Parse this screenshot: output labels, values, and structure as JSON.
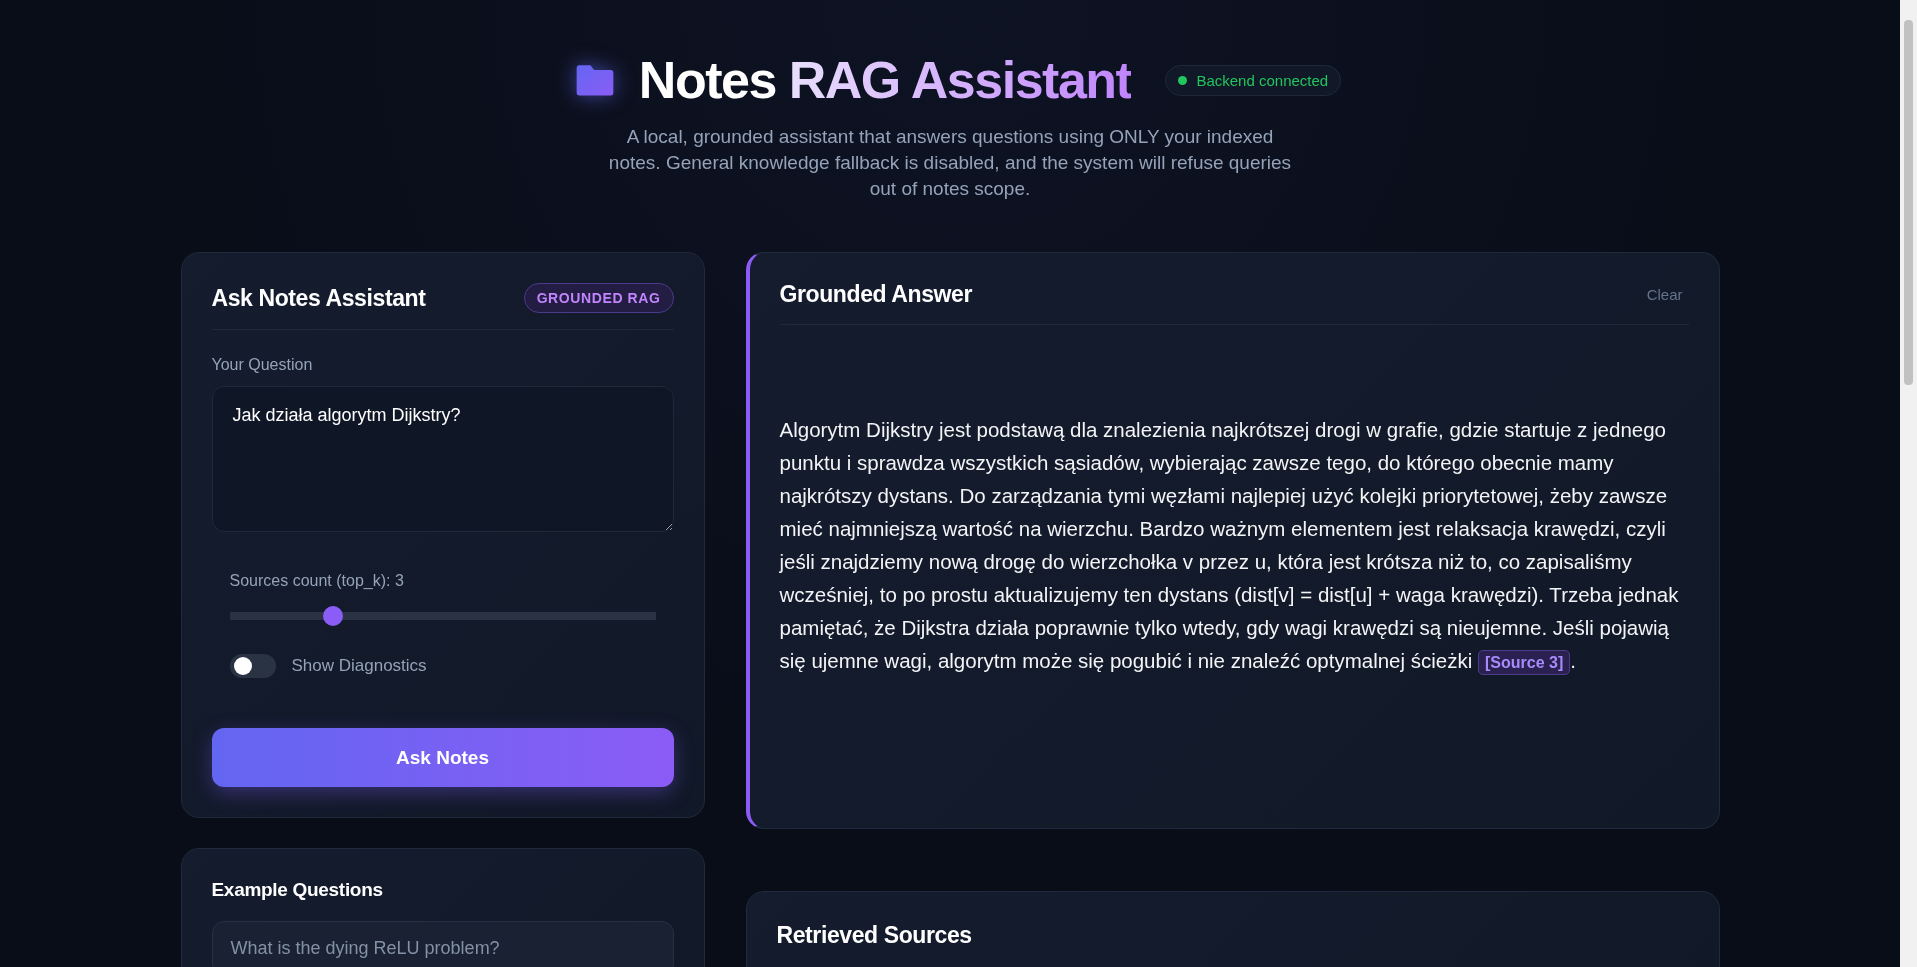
{
  "header": {
    "title_start": "Notes",
    "title_end": "RAG Assistant",
    "status": {
      "label": "Backend connected",
      "connected": true
    },
    "subtitle": "A local, grounded assistant that answers questions using ONLY your indexed notes. General knowledge fallback is disabled, and the system will refuse queries out of notes scope."
  },
  "ask_panel": {
    "title": "Ask Notes Assistant",
    "badge": "GROUNDED RAG",
    "question_label": "Your Question",
    "question_value": "Jak działa algorytm Dijkstry?",
    "slider": {
      "label": "Sources count (top_k): 3",
      "level": 0.23
    },
    "diagnostics_toggle": {
      "label": "Show Diagnostics",
      "checked": false
    },
    "submit_button": "Ask Notes"
  },
  "examples_panel": {
    "title": "Example Questions",
    "items": [
      "What is the dying ReLU problem?"
    ]
  },
  "answer_panel": {
    "title": "Grounded Answer",
    "clear_button": "Clear",
    "text": "Algorytm Dijkstry jest podstawą dla znalezienia najkrótszej drogi w grafie, gdzie startuje z jednego punktu i sprawdza wszystkich sąsiadów, wybierając zawsze tego, do którego obecnie mamy najkrótszy dystans. Do zarządzania tymi węzłami najlepiej użyć kolejki priorytetowej, żeby zawsze mieć najmniejszą wartość na wierzchu. Bardzo ważnym elementem jest relaksacja krawędzi, czyli jeśli znajdziemy nową drogę do wierzchołka v przez u, która jest krótsza niż to, co zapisaliśmy wcześniej, to po prostu aktualizujemy ten dystans (dist[v] = dist[u] + waga krawędzi). Trzeba jednak pamiętać, że Dijkstra działa poprawnie tylko wtedy, gdy wagi krawędzi są nieujemne. Jeśli pojawią się ujemne wagi, algorytm może się pogubić i nie znaleźć optymalnej ścieżki",
    "citation": "[Source 3]",
    "end": "."
  },
  "sources_panel": {
    "title": "Retrieved Sources"
  }
}
